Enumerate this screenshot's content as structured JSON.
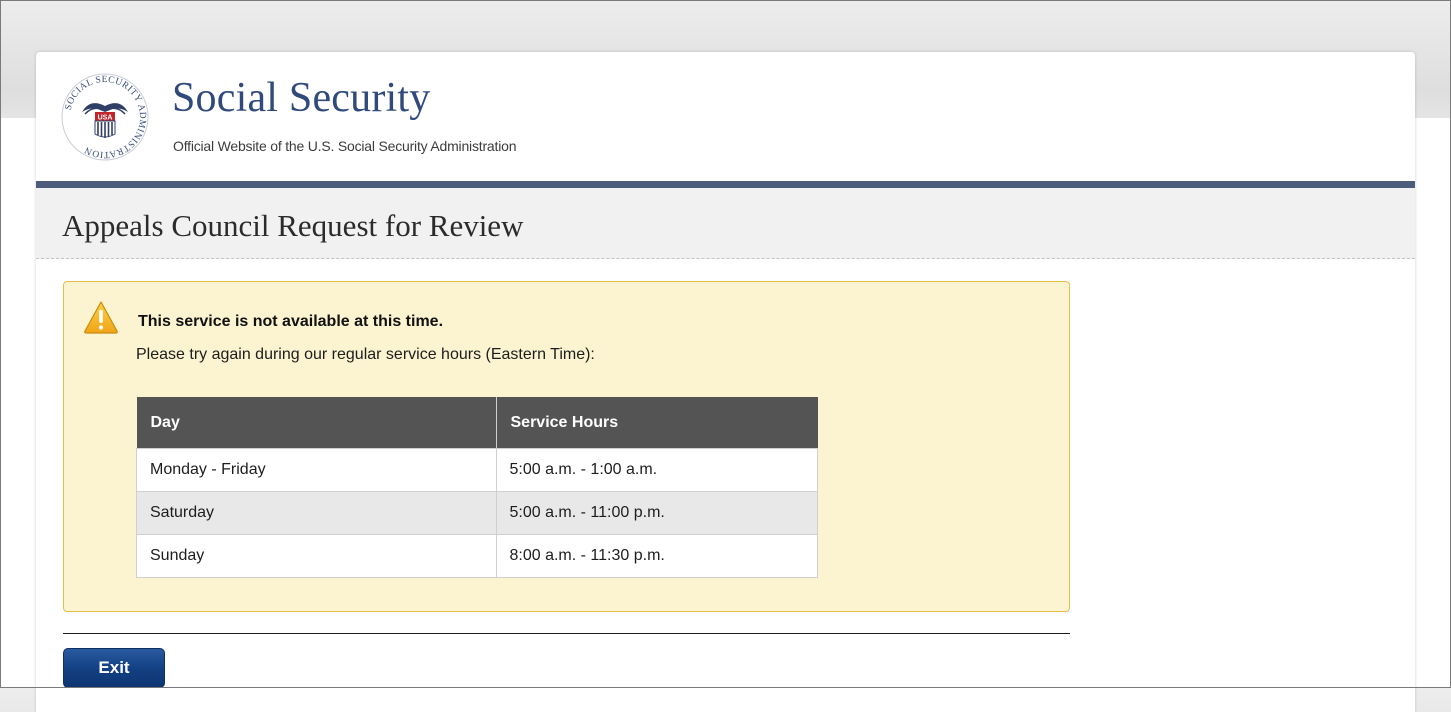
{
  "header": {
    "title": "Social Security",
    "subtitle": "Official Website of the U.S. Social Security Administration",
    "seal": {
      "ring_text": "SOCIAL SECURITY ADMINISTRATION",
      "center_text": "USA"
    }
  },
  "page": {
    "title": "Appeals Council Request for Review"
  },
  "alert": {
    "heading": "This service is not available at this time.",
    "message": "Please try again during our regular service hours (Eastern Time):",
    "icon": "warning-icon"
  },
  "hours_table": {
    "headers": [
      "Day",
      "Service Hours"
    ],
    "rows": [
      [
        "Monday - Friday",
        "5:00 a.m. - 1:00 a.m."
      ],
      [
        "Saturday",
        "5:00 a.m. - 11:00 p.m."
      ],
      [
        "Sunday",
        "8:00 a.m. - 11:30 p.m."
      ]
    ]
  },
  "actions": {
    "exit_label": "Exit"
  },
  "colors": {
    "brand_blue": "#2f4a7b",
    "header_rule": "#4e5c7b",
    "alert_bg": "#fcf3d0",
    "alert_border": "#e3c04b",
    "table_header_bg": "#555454",
    "button_blue": "#123f82"
  }
}
